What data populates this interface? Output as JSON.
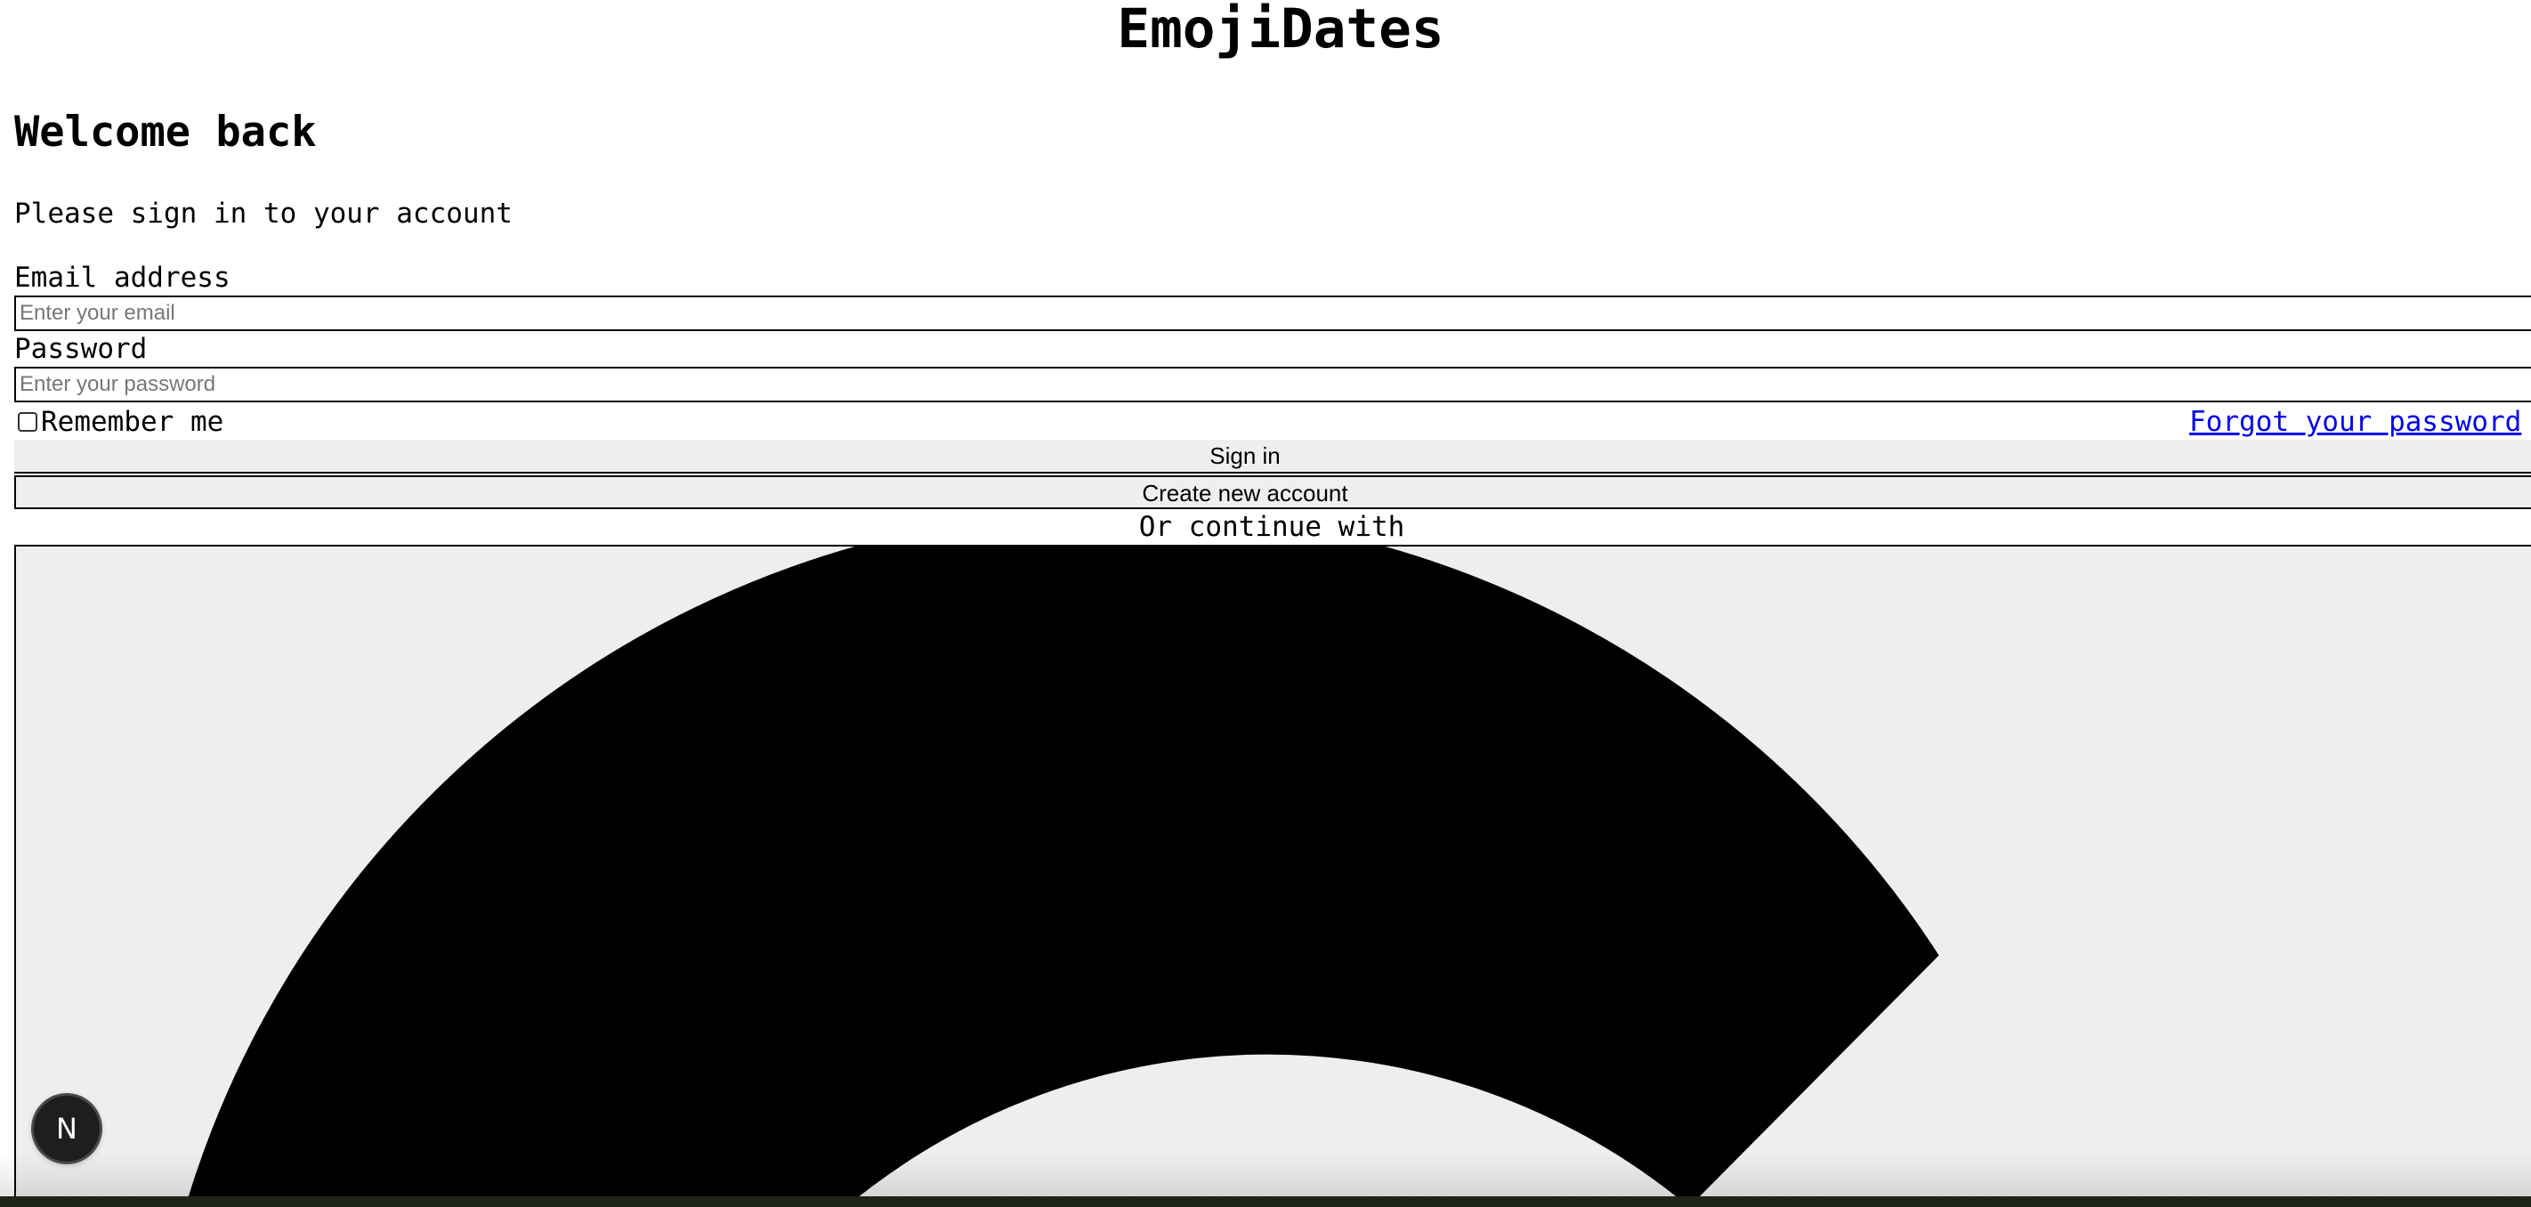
{
  "app": {
    "title": "EmojiDates"
  },
  "login": {
    "heading": "Welcome back",
    "subtitle": "Please sign in to your account",
    "email_label": "Email address",
    "email_placeholder": "Enter your email",
    "email_value": "",
    "password_label": "Password",
    "password_placeholder": "Enter your password",
    "password_value": "",
    "remember_label": "Remember me",
    "remember_checked": false,
    "forgot_link": "Forgot your password",
    "signin_button": "Sign in",
    "create_account_button": "Create new account",
    "divider": "Or continue with"
  },
  "providers": [
    {
      "icon": "google-g-icon"
    }
  ],
  "dev_badge": {
    "icon": "nextjs-icon",
    "glyph": "N"
  },
  "colors": {
    "link": "#0000ee",
    "button_bg": "#efefef",
    "provider_bg": "#eeeeee",
    "badge_bg": "#1e1e1e"
  }
}
